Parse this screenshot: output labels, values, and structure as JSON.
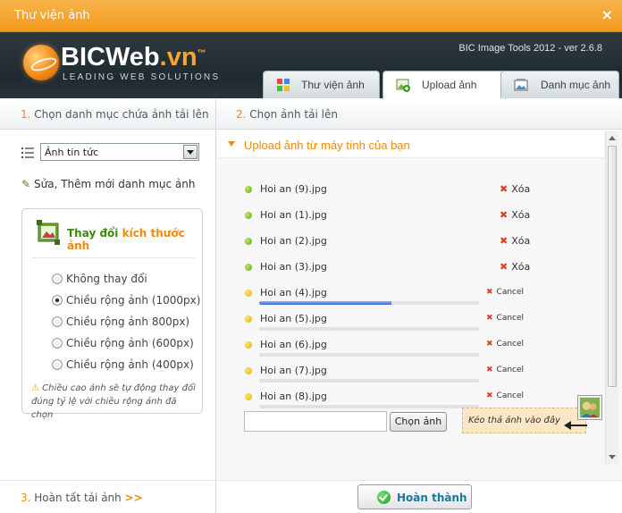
{
  "window": {
    "title": "Thư viện ảnh",
    "close_label": "×"
  },
  "header": {
    "brand_main": "BICWeb",
    "brand_suffix": ".vn",
    "brand_tm": "™",
    "tagline": "LEADING WEB SOLUTIONS",
    "version": "BIC Image Tools 2012 - ver 2.6.8"
  },
  "tabs": [
    {
      "label": "Thư viện ảnh",
      "icon": "palette-icon",
      "active": false
    },
    {
      "label": "Upload ảnh",
      "icon": "upload-image-icon",
      "active": true
    },
    {
      "label": "Danh mục ảnh",
      "icon": "image-category-icon",
      "active": false
    }
  ],
  "steps": {
    "step1_num": "1.",
    "step1": "Chọn danh mục chứa ảnh tải lên",
    "step2_num": "2.",
    "step2": "Chọn ảnh tải lên",
    "step3_num": "3.",
    "step3": "Hoàn tất tải ảnh",
    "step3_arrow": ">>"
  },
  "category": {
    "selected": "Ảnh tin tức",
    "edit_link": "Sửa, Thêm mới danh mục ảnh"
  },
  "resize": {
    "title_a": "Thay đổi",
    "title_b": "kích thước ảnh",
    "options": [
      {
        "label": "Không thay đổi",
        "checked": false
      },
      {
        "label": "Chiều rộng ảnh (1000px)",
        "checked": true
      },
      {
        "label": "Chiều rộng ảnh 800px)",
        "checked": false
      },
      {
        "label": "Chiều rộng ảnh (600px)",
        "checked": false
      },
      {
        "label": "Chiều rộng ảnh (400px)",
        "checked": false
      }
    ],
    "note": "Chiều cao ảnh sẽ tự động thay đổi đúng tỷ lệ với chiều rộng ảnh đã chọn"
  },
  "upload": {
    "section_title": "Upload ảnh từ máy tính của bạn",
    "files": [
      {
        "name": "Hoi an (9).jpg",
        "status": "done",
        "action": "Xóa"
      },
      {
        "name": "Hoi an (1).jpg",
        "status": "done",
        "action": "Xóa"
      },
      {
        "name": "Hoi an (2).jpg",
        "status": "done",
        "action": "Xóa"
      },
      {
        "name": "Hoi an (3).jpg",
        "status": "done",
        "action": "Xóa"
      },
      {
        "name": "Hoi an (4).jpg",
        "status": "uploading",
        "progress": 0.6,
        "action": "Cancel"
      },
      {
        "name": "Hoi an (5).jpg",
        "status": "queued",
        "progress": 0,
        "action": "Cancel"
      },
      {
        "name": "Hoi an (6).jpg",
        "status": "queued",
        "progress": 0,
        "action": "Cancel"
      },
      {
        "name": "Hoi an (7).jpg",
        "status": "queued",
        "progress": 0,
        "action": "Cancel"
      },
      {
        "name": "Hoi an (8).jpg",
        "status": "queued",
        "progress": 0,
        "action": "Cancel"
      }
    ],
    "choose_button": "Chọn ảnh",
    "file_path_value": "",
    "dropzone": "Kéo thả ảnh vào đây"
  },
  "footer": {
    "finish_button": "Hoàn thành"
  },
  "colors": {
    "accent": "#f08a10",
    "title_bar": "#f5a733",
    "header_bg": "#26313a",
    "success": "#1f9b2a"
  }
}
